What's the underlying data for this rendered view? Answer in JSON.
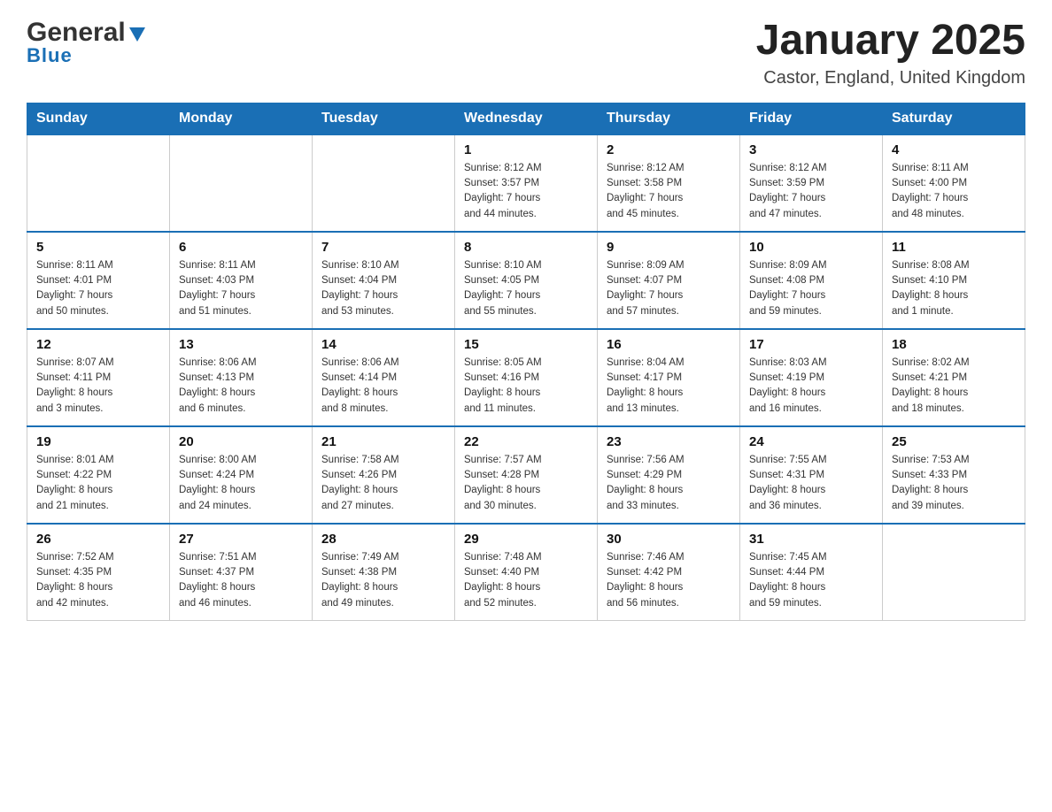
{
  "header": {
    "logo_general": "General",
    "logo_blue": "Blue",
    "month_title": "January 2025",
    "location": "Castor, England, United Kingdom"
  },
  "days_of_week": [
    "Sunday",
    "Monday",
    "Tuesday",
    "Wednesday",
    "Thursday",
    "Friday",
    "Saturday"
  ],
  "weeks": [
    [
      {
        "day": "",
        "info": ""
      },
      {
        "day": "",
        "info": ""
      },
      {
        "day": "",
        "info": ""
      },
      {
        "day": "1",
        "info": "Sunrise: 8:12 AM\nSunset: 3:57 PM\nDaylight: 7 hours\nand 44 minutes."
      },
      {
        "day": "2",
        "info": "Sunrise: 8:12 AM\nSunset: 3:58 PM\nDaylight: 7 hours\nand 45 minutes."
      },
      {
        "day": "3",
        "info": "Sunrise: 8:12 AM\nSunset: 3:59 PM\nDaylight: 7 hours\nand 47 minutes."
      },
      {
        "day": "4",
        "info": "Sunrise: 8:11 AM\nSunset: 4:00 PM\nDaylight: 7 hours\nand 48 minutes."
      }
    ],
    [
      {
        "day": "5",
        "info": "Sunrise: 8:11 AM\nSunset: 4:01 PM\nDaylight: 7 hours\nand 50 minutes."
      },
      {
        "day": "6",
        "info": "Sunrise: 8:11 AM\nSunset: 4:03 PM\nDaylight: 7 hours\nand 51 minutes."
      },
      {
        "day": "7",
        "info": "Sunrise: 8:10 AM\nSunset: 4:04 PM\nDaylight: 7 hours\nand 53 minutes."
      },
      {
        "day": "8",
        "info": "Sunrise: 8:10 AM\nSunset: 4:05 PM\nDaylight: 7 hours\nand 55 minutes."
      },
      {
        "day": "9",
        "info": "Sunrise: 8:09 AM\nSunset: 4:07 PM\nDaylight: 7 hours\nand 57 minutes."
      },
      {
        "day": "10",
        "info": "Sunrise: 8:09 AM\nSunset: 4:08 PM\nDaylight: 7 hours\nand 59 minutes."
      },
      {
        "day": "11",
        "info": "Sunrise: 8:08 AM\nSunset: 4:10 PM\nDaylight: 8 hours\nand 1 minute."
      }
    ],
    [
      {
        "day": "12",
        "info": "Sunrise: 8:07 AM\nSunset: 4:11 PM\nDaylight: 8 hours\nand 3 minutes."
      },
      {
        "day": "13",
        "info": "Sunrise: 8:06 AM\nSunset: 4:13 PM\nDaylight: 8 hours\nand 6 minutes."
      },
      {
        "day": "14",
        "info": "Sunrise: 8:06 AM\nSunset: 4:14 PM\nDaylight: 8 hours\nand 8 minutes."
      },
      {
        "day": "15",
        "info": "Sunrise: 8:05 AM\nSunset: 4:16 PM\nDaylight: 8 hours\nand 11 minutes."
      },
      {
        "day": "16",
        "info": "Sunrise: 8:04 AM\nSunset: 4:17 PM\nDaylight: 8 hours\nand 13 minutes."
      },
      {
        "day": "17",
        "info": "Sunrise: 8:03 AM\nSunset: 4:19 PM\nDaylight: 8 hours\nand 16 minutes."
      },
      {
        "day": "18",
        "info": "Sunrise: 8:02 AM\nSunset: 4:21 PM\nDaylight: 8 hours\nand 18 minutes."
      }
    ],
    [
      {
        "day": "19",
        "info": "Sunrise: 8:01 AM\nSunset: 4:22 PM\nDaylight: 8 hours\nand 21 minutes."
      },
      {
        "day": "20",
        "info": "Sunrise: 8:00 AM\nSunset: 4:24 PM\nDaylight: 8 hours\nand 24 minutes."
      },
      {
        "day": "21",
        "info": "Sunrise: 7:58 AM\nSunset: 4:26 PM\nDaylight: 8 hours\nand 27 minutes."
      },
      {
        "day": "22",
        "info": "Sunrise: 7:57 AM\nSunset: 4:28 PM\nDaylight: 8 hours\nand 30 minutes."
      },
      {
        "day": "23",
        "info": "Sunrise: 7:56 AM\nSunset: 4:29 PM\nDaylight: 8 hours\nand 33 minutes."
      },
      {
        "day": "24",
        "info": "Sunrise: 7:55 AM\nSunset: 4:31 PM\nDaylight: 8 hours\nand 36 minutes."
      },
      {
        "day": "25",
        "info": "Sunrise: 7:53 AM\nSunset: 4:33 PM\nDaylight: 8 hours\nand 39 minutes."
      }
    ],
    [
      {
        "day": "26",
        "info": "Sunrise: 7:52 AM\nSunset: 4:35 PM\nDaylight: 8 hours\nand 42 minutes."
      },
      {
        "day": "27",
        "info": "Sunrise: 7:51 AM\nSunset: 4:37 PM\nDaylight: 8 hours\nand 46 minutes."
      },
      {
        "day": "28",
        "info": "Sunrise: 7:49 AM\nSunset: 4:38 PM\nDaylight: 8 hours\nand 49 minutes."
      },
      {
        "day": "29",
        "info": "Sunrise: 7:48 AM\nSunset: 4:40 PM\nDaylight: 8 hours\nand 52 minutes."
      },
      {
        "day": "30",
        "info": "Sunrise: 7:46 AM\nSunset: 4:42 PM\nDaylight: 8 hours\nand 56 minutes."
      },
      {
        "day": "31",
        "info": "Sunrise: 7:45 AM\nSunset: 4:44 PM\nDaylight: 8 hours\nand 59 minutes."
      },
      {
        "day": "",
        "info": ""
      }
    ]
  ]
}
